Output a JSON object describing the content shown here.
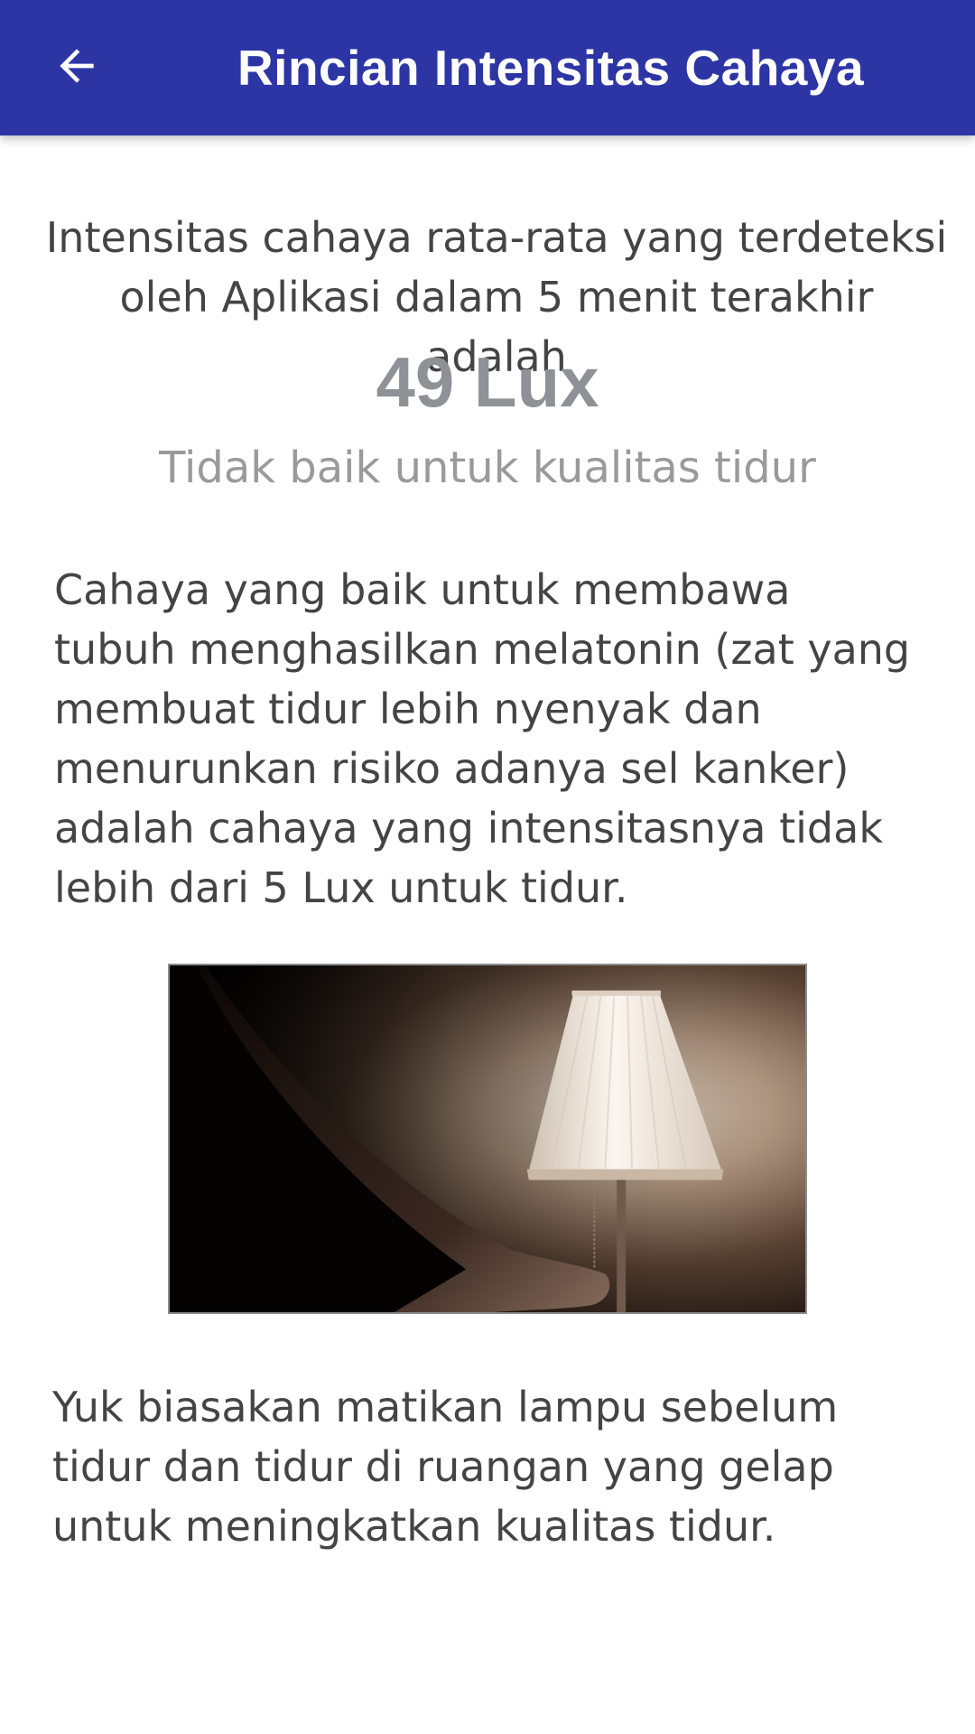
{
  "app_bar": {
    "title": "Rincian Intensitas Cahaya",
    "back_icon": "arrow-left-icon",
    "background_color": "#2d35a5"
  },
  "summary": {
    "intro": "Intensitas cahaya rata-rata yang terdeteksi oleh Aplikasi dalam 5 menit terakhir adalah",
    "lux_value": "49 Lux",
    "status": "Tidak baik untuk kualitas tidur"
  },
  "explanation": "Cahaya yang baik untuk membawa tubuh menghasilkan melatonin (zat yang membuat tidur lebih nyenyak dan menurunkan risiko adanya sel kanker) adalah cahaya yang intensitasnya tidak lebih dari 5 Lux untuk tidur.",
  "image": {
    "name": "lamp-photo"
  },
  "tip": "Yuk biasakan matikan lampu sebelum tidur dan tidur di ruangan yang gelap untuk meningkatkan kualitas tidur."
}
